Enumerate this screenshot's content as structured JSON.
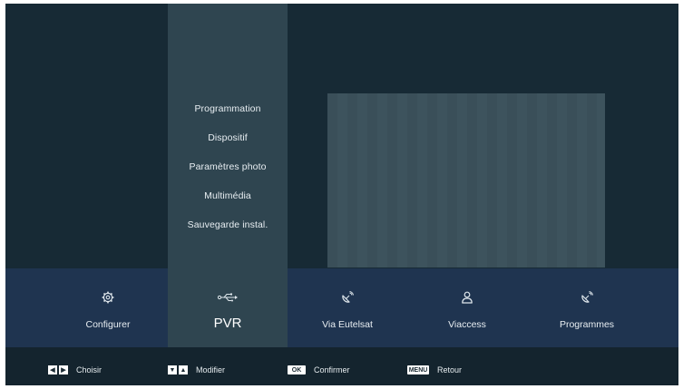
{
  "submenu": {
    "items": [
      {
        "label": "Programmation"
      },
      {
        "label": "Dispositif"
      },
      {
        "label": "Paramètres photo"
      },
      {
        "label": "Multimédia"
      },
      {
        "label": "Sauvegarde instal."
      }
    ]
  },
  "main_menu": {
    "tiles": [
      {
        "label": "Configurer",
        "icon": "gear-icon",
        "active": false
      },
      {
        "label": "PVR",
        "icon": "usb-icon",
        "active": true
      },
      {
        "label": "Via Eutelsat",
        "icon": "satellite-icon",
        "active": false
      },
      {
        "label": "Viaccess",
        "icon": "user-icon",
        "active": false
      },
      {
        "label": "Programmes",
        "icon": "satellite-icon",
        "active": false
      }
    ]
  },
  "footer": {
    "hints": [
      {
        "key": "left-right-arrows",
        "label": "Choisir"
      },
      {
        "key": "down-up-arrows",
        "label": "Modifier"
      },
      {
        "key": "OK",
        "label": "Confirmer"
      },
      {
        "key": "MENU",
        "label": "Retour"
      }
    ]
  },
  "colors": {
    "background": "#172a35",
    "panel": "#2f4550",
    "menu_bar": "#1f3450",
    "footer": "#14242e",
    "preview": "#3b5059"
  }
}
